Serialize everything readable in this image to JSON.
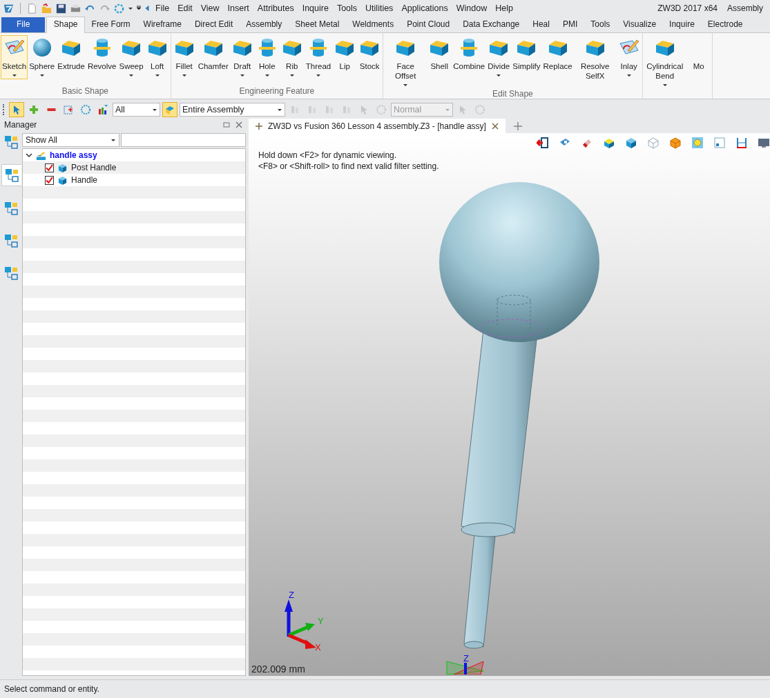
{
  "menu_bar": {
    "items": [
      "File",
      "Edit",
      "View",
      "Insert",
      "Attributes",
      "Inquire",
      "Tools",
      "Utilities",
      "Applications",
      "Window",
      "Help"
    ],
    "app_title": "ZW3D 2017  x64",
    "mode": "Assembly"
  },
  "ribbon_tabs": [
    {
      "label": "File",
      "kind": "app"
    },
    {
      "label": "Shape",
      "kind": "tab",
      "selected": true
    },
    {
      "label": "Free Form",
      "kind": "tab",
      "selected": false
    },
    {
      "label": "Wireframe",
      "kind": "tab",
      "selected": false
    },
    {
      "label": "Direct Edit",
      "kind": "tab",
      "selected": false
    },
    {
      "label": "Assembly",
      "kind": "tab",
      "selected": false
    },
    {
      "label": "Sheet Metal",
      "kind": "tab",
      "selected": false
    },
    {
      "label": "Weldments",
      "kind": "tab",
      "selected": false
    },
    {
      "label": "Point Cloud",
      "kind": "tab",
      "selected": false
    },
    {
      "label": "Data Exchange",
      "kind": "tab",
      "selected": false
    },
    {
      "label": "Heal",
      "kind": "tab",
      "selected": false
    },
    {
      "label": "PMI",
      "kind": "tab",
      "selected": false
    },
    {
      "label": "Tools",
      "kind": "tab",
      "selected": false
    },
    {
      "label": "Visualize",
      "kind": "tab",
      "selected": false
    },
    {
      "label": "Inquire",
      "kind": "tab",
      "selected": false
    },
    {
      "label": "Electrode",
      "kind": "tab",
      "selected": false
    }
  ],
  "ribbon_groups": [
    {
      "title": "Basic Shape",
      "items": [
        {
          "label": "Sketch",
          "dropdown": true,
          "selected": true
        },
        {
          "label": "Sphere",
          "dropdown": true,
          "selected": false
        },
        {
          "label": "Extrude",
          "dropdown": false,
          "selected": false
        },
        {
          "label": "Revolve",
          "dropdown": false,
          "selected": false
        },
        {
          "label": "Sweep",
          "dropdown": true,
          "selected": false
        },
        {
          "label": "Loft",
          "dropdown": true,
          "selected": false
        }
      ]
    },
    {
      "title": "Engineering Feature",
      "items": [
        {
          "label": "Fillet",
          "dropdown": true,
          "selected": false
        },
        {
          "label": "Chamfer",
          "dropdown": false,
          "selected": false
        },
        {
          "label": "Draft",
          "dropdown": true,
          "selected": false
        },
        {
          "label": "Hole",
          "dropdown": true,
          "selected": false
        },
        {
          "label": "Rib",
          "dropdown": true,
          "selected": false
        },
        {
          "label": "Thread",
          "dropdown": true,
          "selected": false
        },
        {
          "label": "Lip",
          "dropdown": false,
          "selected": false
        },
        {
          "label": "Stock",
          "dropdown": false,
          "selected": false
        }
      ]
    },
    {
      "title": "Edit Shape",
      "items": [
        {
          "label": "Face Offset",
          "dropdown": true,
          "selected": false
        },
        {
          "label": "Shell",
          "dropdown": false,
          "selected": false
        },
        {
          "label": "Combine",
          "dropdown": false,
          "selected": false
        },
        {
          "label": "Divide",
          "dropdown": true,
          "selected": false
        },
        {
          "label": "Simplify",
          "dropdown": false,
          "selected": false
        },
        {
          "label": "Replace",
          "dropdown": false,
          "selected": false
        },
        {
          "label": "Resolve SelfX",
          "dropdown": false,
          "selected": false
        },
        {
          "label": "Inlay",
          "dropdown": true,
          "selected": false
        }
      ]
    },
    {
      "items": [
        {
          "label": "Cylindrical Bend",
          "dropdown": true,
          "selected": false
        },
        {
          "label": "Mo",
          "dropdown": false,
          "selected": false
        }
      ]
    }
  ],
  "toolbar": [
    {
      "kind": "tool",
      "active": true,
      "disabled": false
    },
    {
      "kind": "tool",
      "active": false,
      "disabled": false
    },
    {
      "kind": "tool",
      "active": false,
      "disabled": false
    },
    {
      "kind": "tool",
      "active": false,
      "disabled": false
    },
    {
      "kind": "tool",
      "active": false,
      "disabled": false
    },
    {
      "kind": "tool",
      "active": false,
      "disabled": false
    },
    {
      "kind": "combo",
      "value": "All",
      "disabled": false
    },
    {
      "kind": "tool",
      "active": true,
      "disabled": false
    },
    {
      "kind": "combo",
      "value": "Entire Assembly",
      "disabled": false
    },
    {
      "kind": "tool",
      "active": false,
      "disabled": true
    },
    {
      "kind": "tool",
      "active": false,
      "disabled": true
    },
    {
      "kind": "tool",
      "active": false,
      "disabled": true
    },
    {
      "kind": "tool",
      "active": false,
      "disabled": true
    },
    {
      "kind": "tool",
      "active": false,
      "disabled": true
    },
    {
      "kind": "tool",
      "active": false,
      "disabled": true
    },
    {
      "kind": "combo",
      "value": "Normal",
      "disabled": true
    },
    {
      "kind": "tool",
      "active": false,
      "disabled": true
    },
    {
      "kind": "tool",
      "active": false,
      "disabled": true
    }
  ],
  "side_strip": [
    {
      "selected": false
    },
    {
      "selected": true
    },
    {
      "selected": false
    },
    {
      "selected": false
    },
    {
      "selected": false
    }
  ],
  "manager": {
    "title": "Manager",
    "filter": "Show All",
    "tree": [
      {
        "label": "handle assy",
        "expanded": true,
        "children": [
          {
            "label": "Post Handle",
            "checked": true
          },
          {
            "label": "Handle",
            "checked": true
          }
        ]
      }
    ]
  },
  "viewport": {
    "document_tab": "ZW3D vs Fusion 360 Lesson 4 assembly.Z3 - [handle assy]",
    "hints": [
      "Hold down <F2> for dynamic viewing.",
      "<F8> or <Shift-roll> to find next valid filter setting."
    ],
    "triad": {
      "x": "X",
      "y": "Y",
      "z": "Z"
    },
    "origin_label": "Z",
    "scale": "202.009 mm"
  },
  "status_bar": "Select command or entity."
}
